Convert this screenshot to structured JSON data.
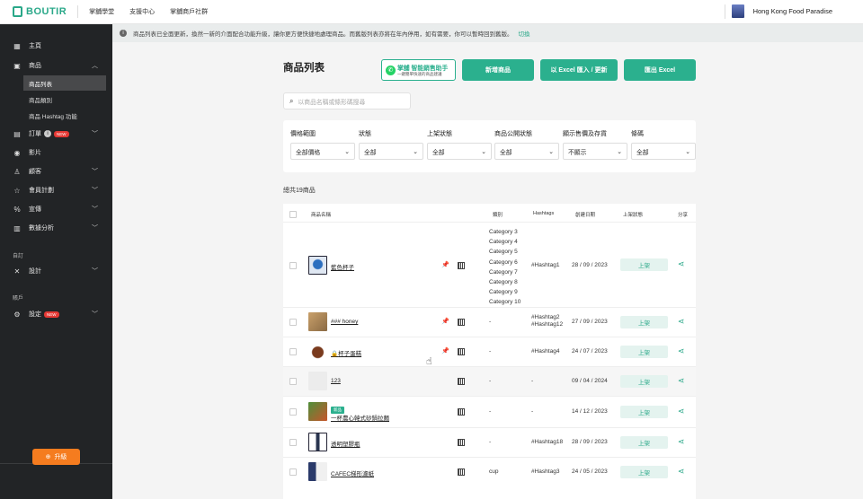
{
  "topbar": {
    "logo": "BOUTIR",
    "links": [
      "掌舖學堂",
      "支援中心",
      "掌舖商戶社群"
    ],
    "store_name": "Hong Kong Food Paradise"
  },
  "sidebar": {
    "items": [
      {
        "label": "主頁",
        "icon": "dashboard-icon"
      },
      {
        "label": "商品",
        "icon": "product-icon"
      },
      {
        "label": "訂單",
        "icon": "order-icon"
      },
      {
        "label": "影片",
        "icon": "video-icon"
      },
      {
        "label": "顧客",
        "icon": "customer-icon"
      },
      {
        "label": "會員計劃",
        "icon": "star-icon"
      },
      {
        "label": "宣傳",
        "icon": "percent-icon"
      },
      {
        "label": "數據分析",
        "icon": "chart-icon"
      },
      {
        "label": "設計",
        "icon": "design-icon"
      },
      {
        "label": "設定",
        "icon": "gear-icon"
      }
    ],
    "sub_items": [
      "商品列表",
      "商品類別",
      "商品 Hashtag 功能"
    ],
    "section_custom": "自訂",
    "section_account": "賬戶",
    "order_badge": "NEW",
    "settings_badge": "NEW",
    "upgrade_label": "升級"
  },
  "notice": {
    "text": "商品列表已全面更新，換然一新的介面配合功能升級，讓你更方便快捷地處理商品。而舊版列表亦將在年內停用，如有需要，你可以暫時回到舊版。",
    "link": "切換"
  },
  "main": {
    "title": "商品列表",
    "whatsapp_title": "掌舖 智能銷售助手",
    "whatsapp_sub": "一鍵簡單快速的商品建議",
    "add_button": "新增商品",
    "import_button": "以 Excel 匯入 / 更新",
    "export_button": "匯出 Excel",
    "search_placeholder": "以商品名稱或條形碼搜尋",
    "filters": [
      {
        "label": "價格範圍",
        "value": "全部價格"
      },
      {
        "label": "狀態",
        "value": "全部"
      },
      {
        "label": "上架狀態",
        "value": "全部"
      },
      {
        "label": "商品公開狀態",
        "value": "全部"
      },
      {
        "label": "顯示售價及存貨",
        "value": "不顯示"
      },
      {
        "label": "條碼",
        "value": "全部"
      }
    ],
    "count": "總共19商品"
  },
  "table": {
    "headers": [
      "商品名稱",
      "類別",
      "Hashtags",
      "創建日期",
      "上架狀態",
      "分享"
    ],
    "rows": [
      {
        "name": "藍色杯子",
        "categories": [
          "Category 3",
          "Category 4",
          "Category 5",
          "Category 6",
          "Category 7",
          "Category 8",
          "Category 9",
          "Category 10"
        ],
        "hashtags": "#Hashtag1",
        "date": "28 / 09 / 2023",
        "status": "上架"
      },
      {
        "name": "### honey",
        "category": "-",
        "hashtags1": "#Hashtag2",
        "hashtags2": "#Hashtag12",
        "date": "27 / 09 / 2023",
        "status": "上架"
      },
      {
        "name": "杯子蛋糕",
        "category": "-",
        "hashtags": "#Hashtag4",
        "date": "24 / 07 / 2023",
        "status": "上架"
      },
      {
        "name": "123",
        "category": "-",
        "hashtags": "-",
        "date": "09 / 04 / 2024",
        "status": "上架"
      },
      {
        "tag": "新品",
        "name": "一杯農心韓式砂鍋拉麵",
        "category": "-",
        "hashtags": "-",
        "date": "14 / 12 / 2023",
        "status": "上架"
      },
      {
        "name": "透明塑膠瓶",
        "category": "-",
        "hashtags": "#Hashtag18",
        "date": "28 / 09 / 2023",
        "status": "上架"
      },
      {
        "name": "CAFEC梯形濾紙",
        "category": "cup",
        "hashtags": "#Hashtag3",
        "date": "24 / 05 / 2023",
        "status": "上架"
      }
    ]
  }
}
